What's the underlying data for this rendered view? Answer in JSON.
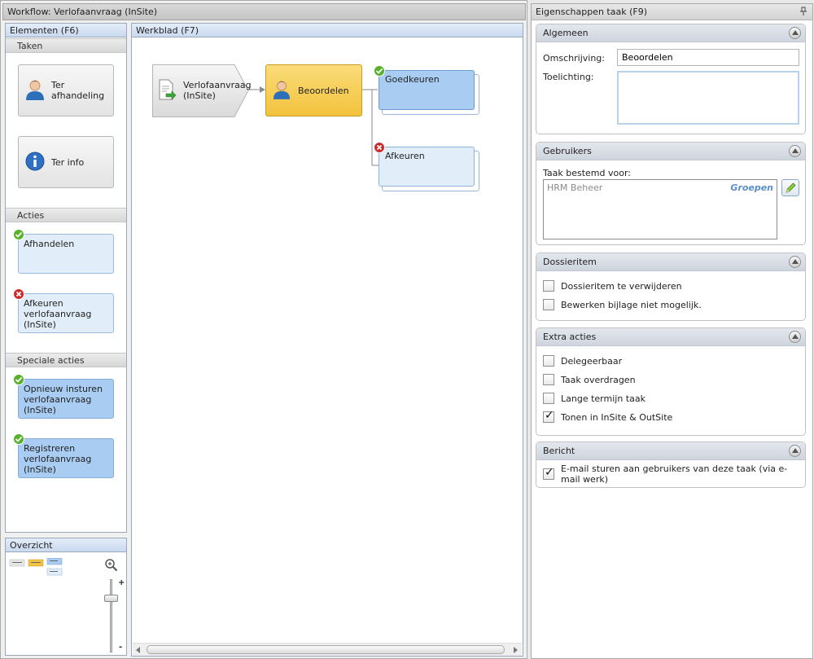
{
  "workflow": {
    "title": "Workflow: Verlofaanvraag (InSite)"
  },
  "elements": {
    "header": "Elementen (F6)",
    "taken": {
      "title": "Taken",
      "items": [
        "Ter afhandeling",
        "Ter info"
      ]
    },
    "acties": {
      "title": "Acties",
      "items": [
        "Afhandelen",
        "Afkeuren verlofaanvraag (InSite)"
      ]
    },
    "speciale_acties": {
      "title": "Speciale acties",
      "items": [
        "Opnieuw insturen verlofaanvraag (InSite)",
        "Registreren verlofaanvraag (InSite)"
      ]
    }
  },
  "overview": {
    "header": "Overzicht",
    "zoom_plus": "+",
    "zoom_minus": "-"
  },
  "worksheet": {
    "header": "Werkblad (F7)",
    "nodes": {
      "start": "Verlofaanvraag (InSite)",
      "task": "Beoordelen",
      "approve": "Goedkeuren",
      "reject": "Afkeuren"
    }
  },
  "properties": {
    "title": "Eigenschappen taak (F9)",
    "algemeen": {
      "title": "Algemeen",
      "omschrijving_label": "Omschrijving:",
      "omschrijving_value": "Beoordelen",
      "toelichting_label": "Toelichting:",
      "toelichting_value": ""
    },
    "gebruikers": {
      "title": "Gebruikers",
      "label": "Taak bestemd voor:",
      "entries": [
        {
          "name": "HRM Beheer",
          "type": "Groepen"
        }
      ]
    },
    "dossieritem": {
      "title": "Dossieritem",
      "options": [
        {
          "label": "Dossieritem te verwijderen",
          "checked": false
        },
        {
          "label": "Bewerken bijlage niet mogelijk.",
          "checked": false
        }
      ]
    },
    "extra_acties": {
      "title": "Extra acties",
      "options": [
        {
          "label": "Delegeerbaar",
          "checked": false
        },
        {
          "label": "Taak overdragen",
          "checked": false
        },
        {
          "label": "Lange termijn taak",
          "checked": false
        },
        {
          "label": "Tonen in InSite & OutSite",
          "checked": true
        }
      ]
    },
    "bericht": {
      "title": "Bericht",
      "options": [
        {
          "label": "E-mail sturen aan gebruikers van deze taak (via e-mail werk)",
          "checked": true
        }
      ]
    }
  },
  "colors": {
    "task_yellow": "#f2c23c",
    "action_blue": "#a9cdf2",
    "action_light": "#e1eef9",
    "ok_green": "#57b229",
    "error_red": "#cf2b2b",
    "group_link": "#5b8fc9"
  }
}
